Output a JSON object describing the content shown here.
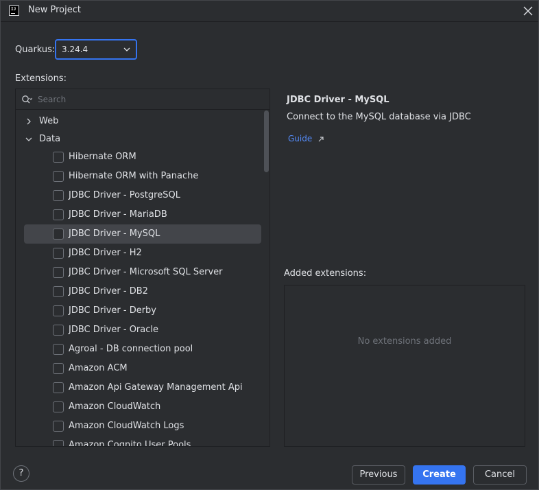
{
  "window": {
    "title": "New Project"
  },
  "quarkus": {
    "label": "Quarkus:",
    "version": "3.24.4"
  },
  "extensions": {
    "label": "Extensions:",
    "search_placeholder": "Search",
    "groups": [
      {
        "label": "Web",
        "expanded": false
      },
      {
        "label": "Data",
        "expanded": true
      }
    ],
    "items": [
      {
        "label": "Hibernate ORM"
      },
      {
        "label": "Hibernate ORM with Panache"
      },
      {
        "label": "JDBC Driver - PostgreSQL"
      },
      {
        "label": "JDBC Driver - MariaDB"
      },
      {
        "label": "JDBC Driver - MySQL"
      },
      {
        "label": "JDBC Driver - H2"
      },
      {
        "label": "JDBC Driver - Microsoft SQL Server"
      },
      {
        "label": "JDBC Driver - DB2"
      },
      {
        "label": "JDBC Driver - Derby"
      },
      {
        "label": "JDBC Driver - Oracle"
      },
      {
        "label": "Agroal - DB connection pool"
      },
      {
        "label": "Amazon ACM"
      },
      {
        "label": "Amazon Api Gateway Management Api"
      },
      {
        "label": "Amazon CloudWatch"
      },
      {
        "label": "Amazon CloudWatch Logs"
      },
      {
        "label": "Amazon Cognito User Pools"
      }
    ],
    "selected_index": 4
  },
  "detail": {
    "title": "JDBC Driver - MySQL",
    "description": "Connect to the MySQL database via JDBC",
    "guide_label": "Guide"
  },
  "added": {
    "label": "Added extensions:",
    "empty_text": "No extensions added"
  },
  "footer": {
    "help": "?",
    "previous": "Previous",
    "create": "Create",
    "cancel": "Cancel"
  },
  "colors": {
    "accent": "#3574f0",
    "link": "#548af7",
    "background": "#2b2d30"
  },
  "icons": {
    "app": "intellij-idea-icon",
    "close": "close-icon",
    "search": "search-icon",
    "expand": "chevron-right-icon",
    "collapse": "chevron-down-icon",
    "external": "external-link-icon",
    "help": "help-icon"
  }
}
